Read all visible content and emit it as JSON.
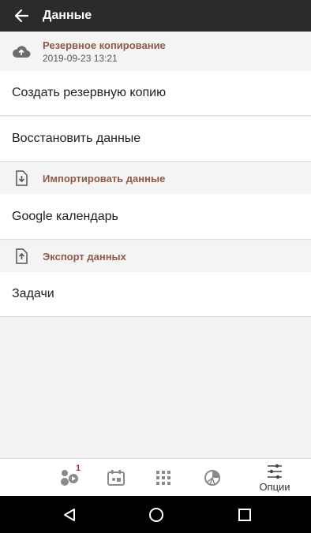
{
  "header": {
    "title": "Данные"
  },
  "backup": {
    "title": "Резервное копирование",
    "date": "2019-09-23 13:21"
  },
  "rows": {
    "create_backup": "Создать резервную копию",
    "restore": "Восстановить данные",
    "google": "Google календарь",
    "tasks": "Задачи"
  },
  "import_section": {
    "title": "Импортировать данные"
  },
  "export_section": {
    "title": "Экспорт данных"
  },
  "bottom_nav": {
    "badge": "1",
    "options_label": "Опции"
  },
  "colors": {
    "accent": "#8d5a45",
    "appbar": "#2b2b2b",
    "badge": "#b13030"
  }
}
